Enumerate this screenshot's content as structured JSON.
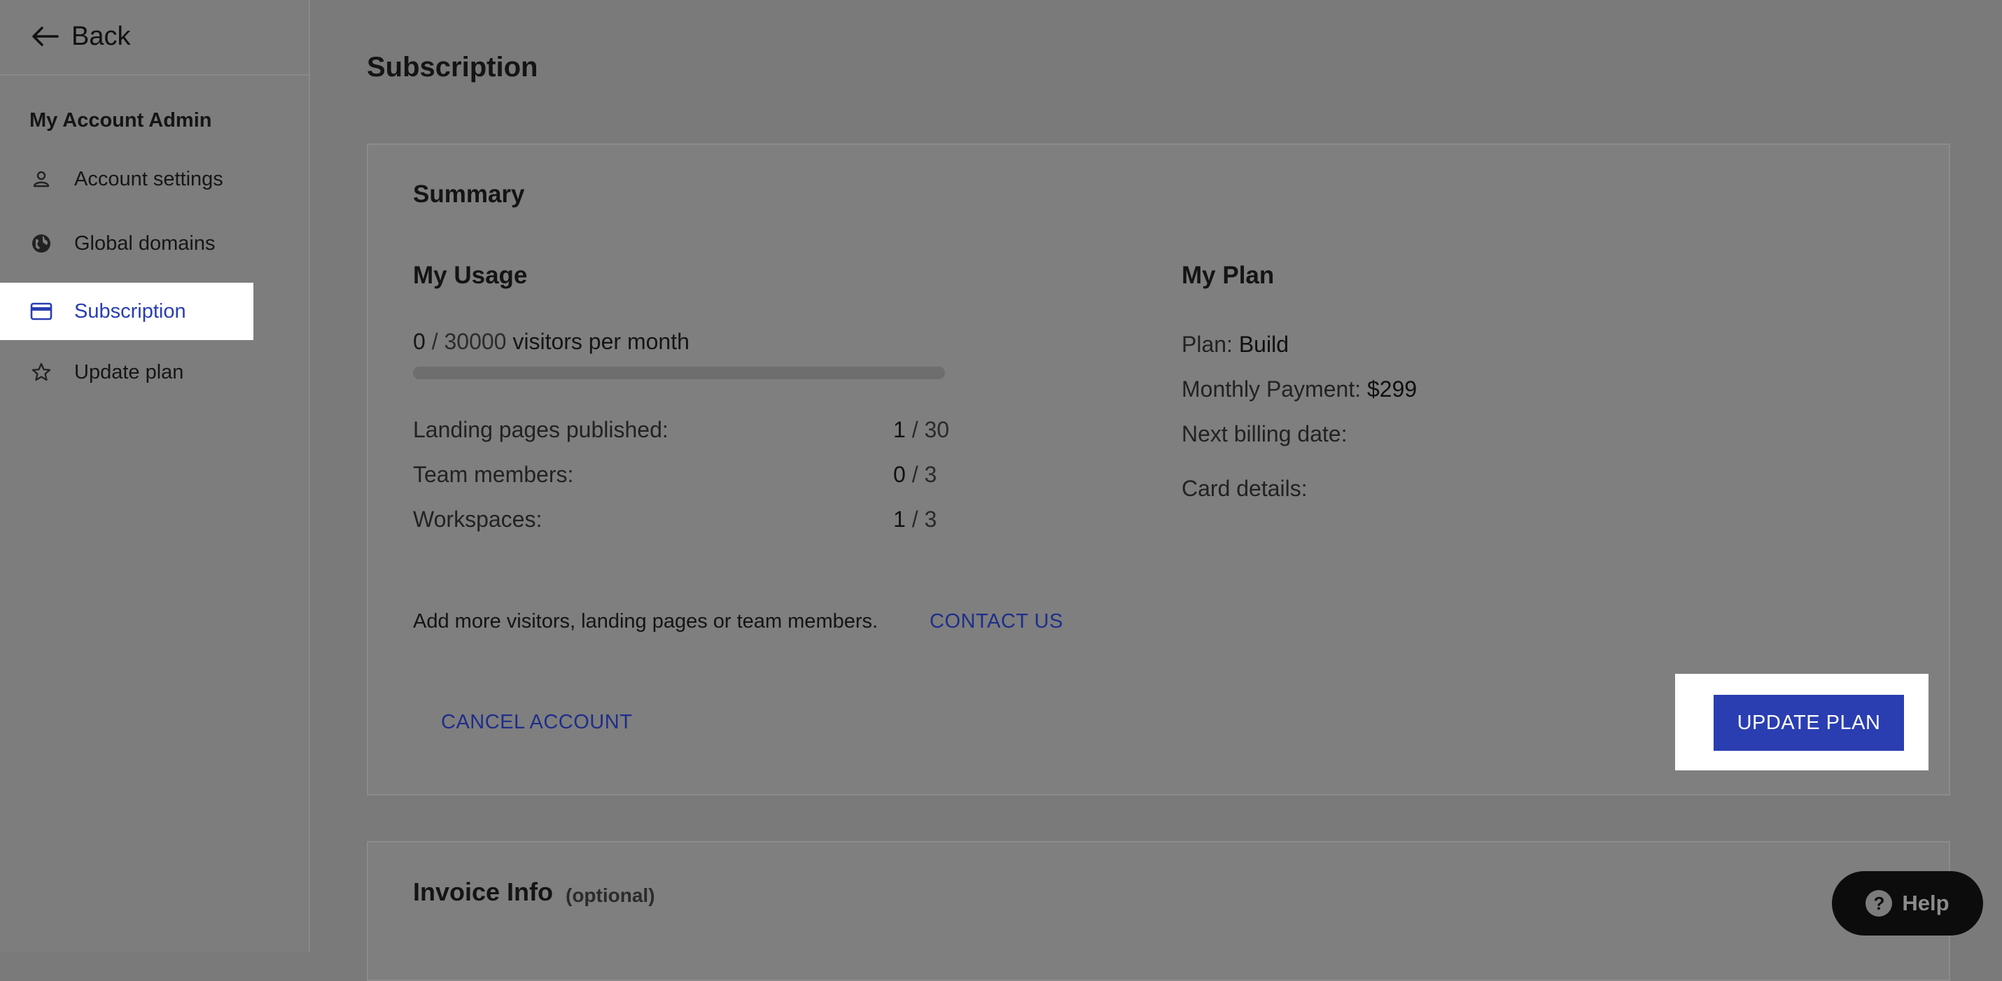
{
  "sidebar": {
    "back_label": "Back",
    "section_title": "My Account Admin",
    "items": [
      {
        "label": "Account settings",
        "icon": "person-icon"
      },
      {
        "label": "Global domains",
        "icon": "globe-icon"
      },
      {
        "label": "Subscription",
        "icon": "credit-card-icon",
        "active": true
      },
      {
        "label": "Update plan",
        "icon": "star-icon"
      }
    ]
  },
  "main": {
    "title": "Subscription",
    "summary": {
      "title": "Summary",
      "usage": {
        "title": "My Usage",
        "visitors_used": "0",
        "visitors_limit": "30000",
        "visitors_suffix": "visitors per month",
        "visitors_progress_fraction": 0,
        "stats": [
          {
            "label": "Landing pages published:",
            "used": "1",
            "limit": "30"
          },
          {
            "label": "Team members:",
            "used": "0",
            "limit": "3"
          },
          {
            "label": "Workspaces:",
            "used": "1",
            "limit": "3"
          }
        ]
      },
      "plan": {
        "title": "My Plan",
        "plan_label": "Plan:",
        "plan_value": "Build",
        "payment_label": "Monthly Payment:",
        "payment_value": "$299",
        "billing_label": "Next billing date:",
        "card_label": "Card details:"
      },
      "add_more_text": "Add more visitors, landing pages or team members.",
      "contact_label": "CONTACT US",
      "cancel_label": "CANCEL ACCOUNT",
      "update_label": "UPDATE PLAN"
    },
    "invoice": {
      "title": "Invoice Info",
      "optional_label": "(optional)"
    }
  },
  "help": {
    "label": "Help"
  },
  "colors": {
    "accent": "#2a3eb1",
    "link": "#1e2e8a",
    "overlay": "#7a7a7a"
  }
}
